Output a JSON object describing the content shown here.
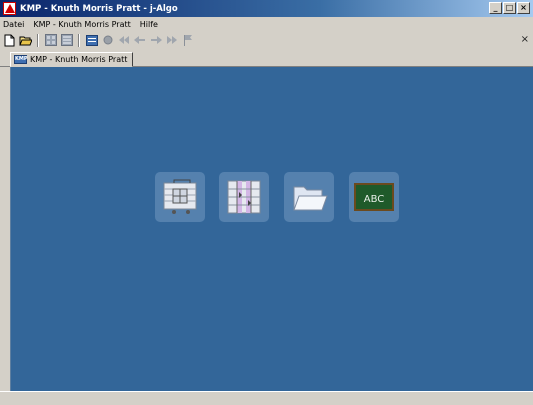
{
  "window": {
    "title": "KMP - Knuth Morris Pratt  -  j-Algo",
    "min_label": "_",
    "max_label": "□",
    "close_label": "×"
  },
  "menu": {
    "items": [
      {
        "label": "Datei"
      },
      {
        "label": "KMP - Knuth Morris Pratt"
      },
      {
        "label": "Hilfe"
      }
    ]
  },
  "toolbar": {
    "icons": [
      "new-file-icon",
      "open-folder-icon",
      "grid-icon",
      "grid-icon",
      "kmp-icon",
      "record-icon",
      "rewind-icon",
      "step-back-icon",
      "step-forward-icon",
      "fast-forward-icon",
      "flag-icon"
    ],
    "close_label": "×"
  },
  "tab": {
    "label": "KMP - Knuth Morris Pratt",
    "icon_text": "KMP"
  },
  "launchers": [
    {
      "name": "pattern-editor-icon"
    },
    {
      "name": "phase-view-icon"
    },
    {
      "name": "open-folder-icon"
    },
    {
      "name": "abc-board-icon",
      "text": "ABC"
    }
  ],
  "colors": {
    "workspace": "#336699",
    "title_start": "#0a246a",
    "title_end": "#a6caf0",
    "chrome": "#d4d0c8"
  }
}
